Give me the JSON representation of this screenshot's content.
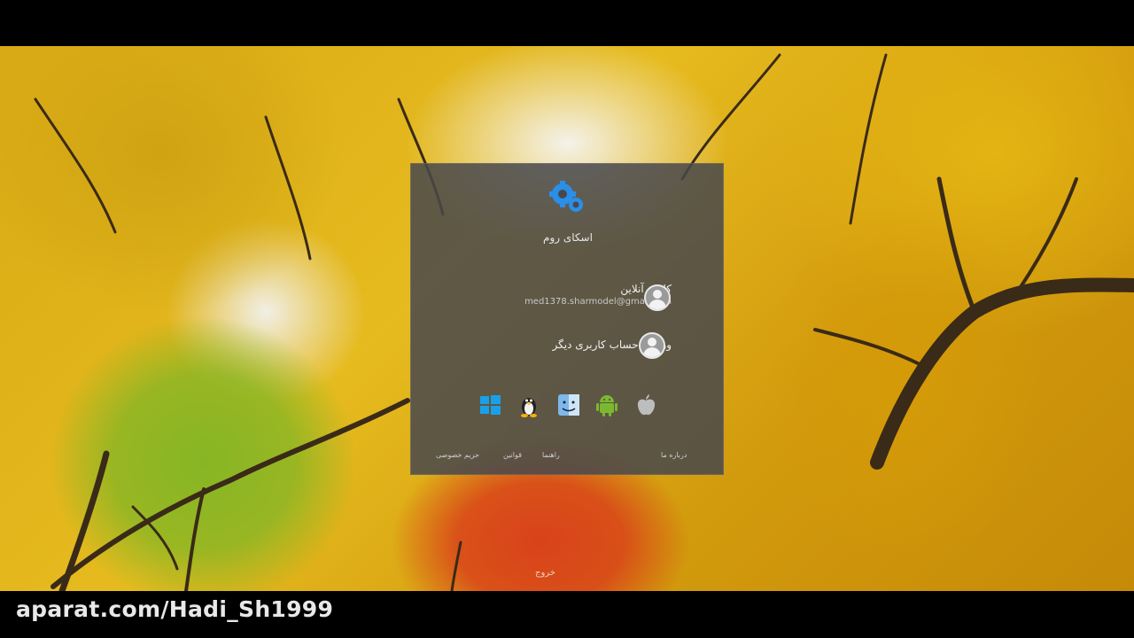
{
  "login": {
    "brand_name": "اسکای روم",
    "accounts": [
      {
        "title": "کلاس آنلاین",
        "email": "med1378.sharmodel@gmail.com"
      },
      {
        "title": "ورود با حساب کاربری دیگر"
      }
    ],
    "os_icons": [
      "windows-icon",
      "linux-icon",
      "macos-finder-icon",
      "android-icon",
      "apple-icon"
    ],
    "footer_links": {
      "privacy": "حریم خصوصی",
      "terms": "قوانین",
      "help": "راهنما",
      "about": "درباره ما"
    }
  },
  "power_hint": "خروج",
  "watermark": "aparat.com/Hadi_Sh1999",
  "colors": {
    "panel": "#48484c",
    "logo_blue": "#2a8fe8",
    "windows_blue": "#1aa0e8",
    "android_green": "#7cb82f"
  }
}
